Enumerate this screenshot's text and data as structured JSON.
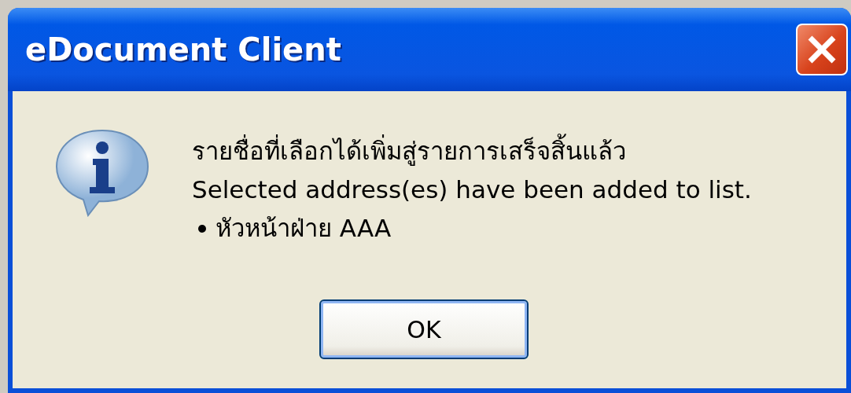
{
  "window": {
    "title": "eDocument Client"
  },
  "message": {
    "lines": [
      "รายชื่อที่เลือกได้เพิ่มสู่รายการเสร็จสิ้นแล้ว",
      "Selected address(es) have been added to list."
    ],
    "items": [
      "หัวหน้าฝ่าย AAA"
    ]
  },
  "buttons": [
    {
      "label": "OK",
      "selected": true
    }
  ]
}
